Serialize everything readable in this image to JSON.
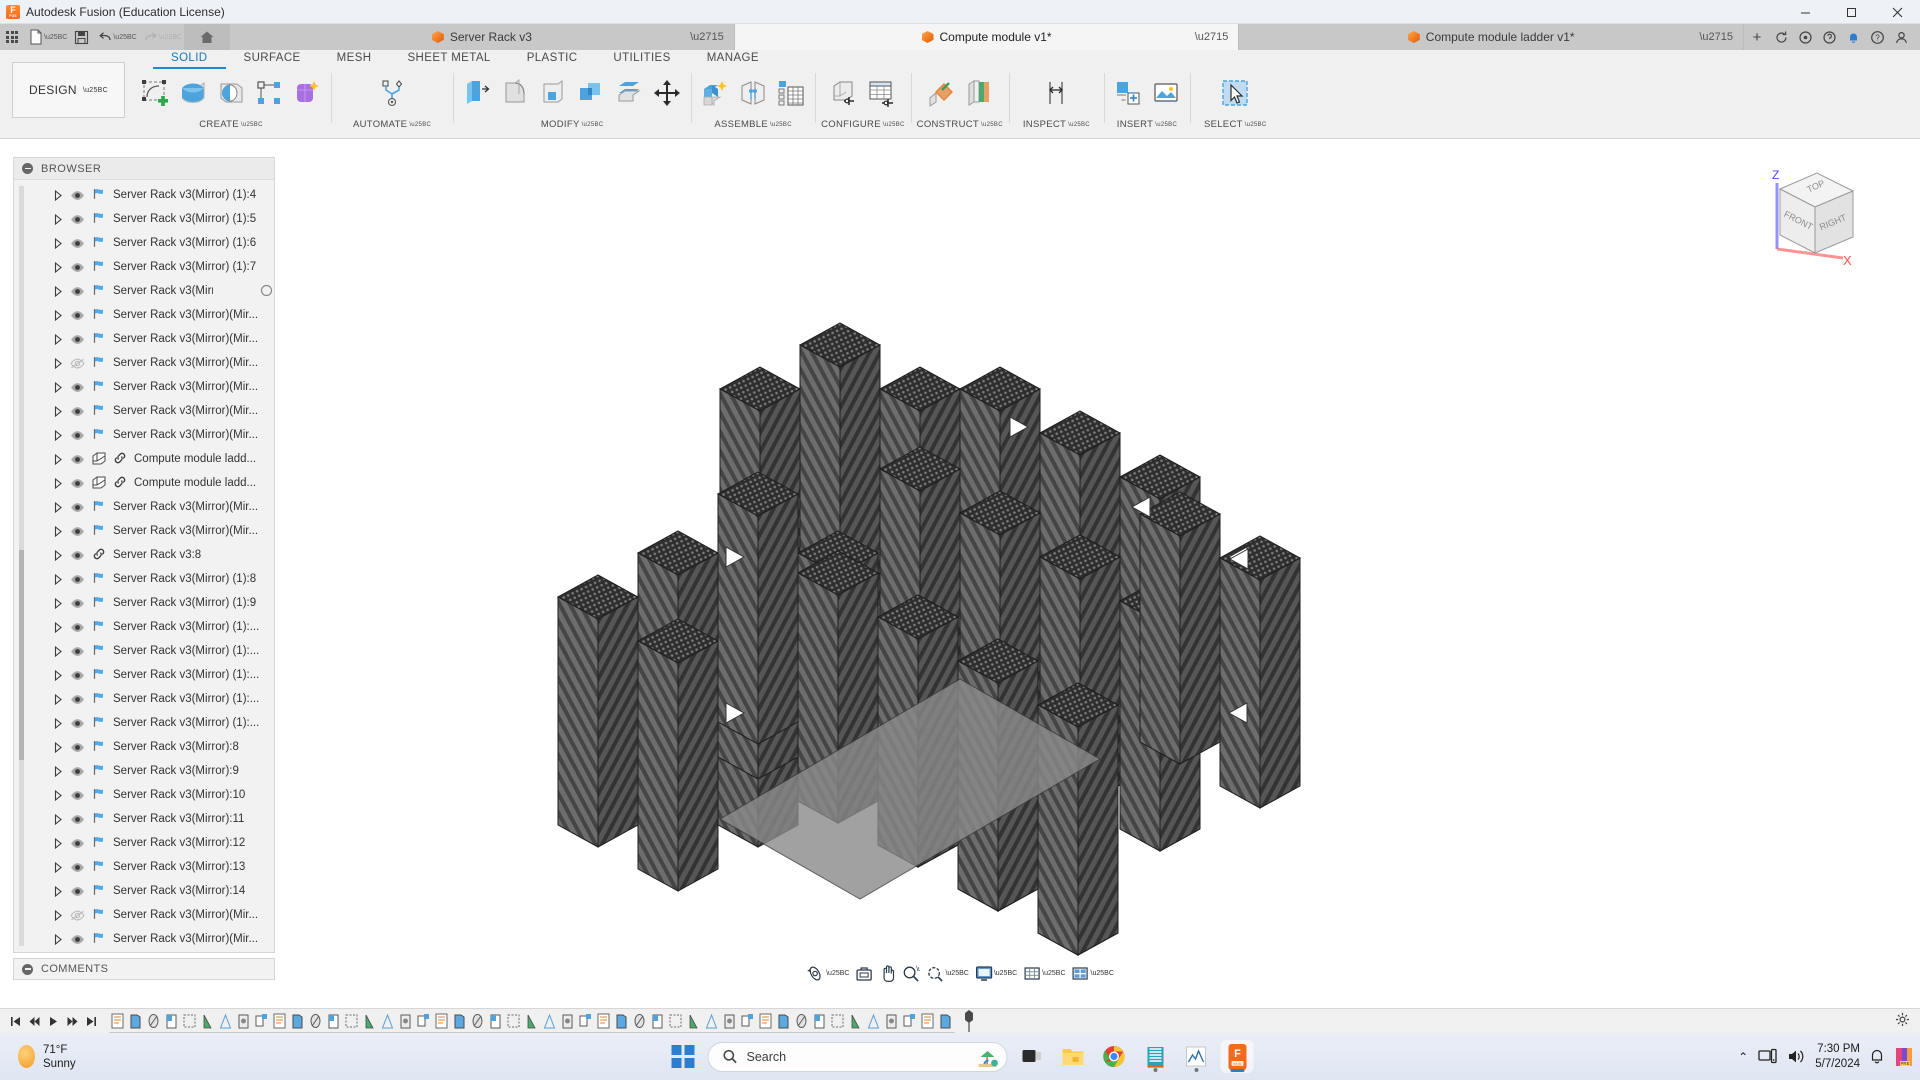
{
  "window": {
    "title": "Autodesk Fusion (Education License)",
    "app_icon": "fusion-logo-icon",
    "minimize": "─",
    "maximize": "□",
    "close": "✕"
  },
  "quick_access": {
    "items": [
      {
        "name": "app-grid-button",
        "icon": "grid-icon"
      },
      {
        "name": "new-file-button",
        "icon": "file-icon",
        "caret": true
      },
      {
        "name": "save-button",
        "icon": "save-icon"
      },
      {
        "name": "undo-button",
        "icon": "undo-arrow-icon",
        "caret": true
      },
      {
        "name": "redo-button",
        "icon": "redo-arrow-icon",
        "caret": true
      }
    ],
    "home_label": "home-icon",
    "add_tab": "+",
    "right_icons": [
      "refresh-icon",
      "extensions-icon",
      "help-circle-icon",
      "notification-bell-icon",
      "help-icon",
      "account-icon"
    ]
  },
  "doc_tabs": [
    {
      "label": "Server Rack v3",
      "active": false,
      "closable": true
    },
    {
      "label": "Compute module v1*",
      "active": true,
      "closable": true
    },
    {
      "label": "Compute module ladder v1*",
      "active": false,
      "closable": true
    }
  ],
  "ribbon": {
    "design_label": "DESIGN",
    "tabs": [
      {
        "label": "SOLID",
        "active": true
      },
      {
        "label": "SURFACE",
        "active": false
      },
      {
        "label": "MESH",
        "active": false
      },
      {
        "label": "SHEET METAL",
        "active": false
      },
      {
        "label": "PLASTIC",
        "active": false
      },
      {
        "label": "UTILITIES",
        "active": false
      },
      {
        "label": "MANAGE",
        "active": false
      }
    ],
    "groups": [
      {
        "label": "CREATE",
        "icons": [
          "sketch-create-icon",
          "extrude-icon",
          "revolve-icon",
          "rectangular-pattern-icon",
          "create-form-icon"
        ]
      },
      {
        "label": "AUTOMATE",
        "icons": [
          "automate-icon"
        ]
      },
      {
        "label": "MODIFY",
        "icons": [
          "press-pull-icon",
          "fillet-icon",
          "shell-icon",
          "combine-icon",
          "offset-face-icon",
          "move-copy-icon"
        ]
      },
      {
        "label": "ASSEMBLE",
        "icons": [
          "new-component-icon",
          "joint-icon",
          "contact-set-icon"
        ]
      },
      {
        "label": "CONFIGURE",
        "icons": [
          "create-configuration-icon",
          "configuration-table-icon"
        ]
      },
      {
        "label": "CONSTRUCT",
        "icons": [
          "offset-plane-icon",
          "plane-along-path-icon"
        ]
      },
      {
        "label": "INSPECT",
        "icons": [
          "measure-icon"
        ]
      },
      {
        "label": "INSERT",
        "icons": [
          "insert-derive-icon",
          "insert-canvas-icon"
        ]
      },
      {
        "label": "SELECT",
        "icons": [
          "select-cursor-icon"
        ]
      }
    ]
  },
  "browser": {
    "title": "BROWSER",
    "footer": "COMMENTS",
    "items": [
      {
        "label": "Server Rack v3(Mirror) (1):4",
        "visible": true,
        "icon": "joint-flag-icon"
      },
      {
        "label": "Server Rack v3(Mirror) (1):5",
        "visible": true,
        "icon": "joint-flag-icon"
      },
      {
        "label": "Server Rack v3(Mirror) (1):6",
        "visible": true,
        "icon": "joint-flag-icon"
      },
      {
        "label": "Server Rack v3(Mirror) (1):7",
        "visible": true,
        "icon": "joint-flag-icon"
      },
      {
        "label": "Server Rack v3(Mirrc...",
        "visible": true,
        "icon": "joint-flag-icon",
        "spinner": true
      },
      {
        "label": "Server Rack v3(Mirror)(Mir...",
        "visible": true,
        "icon": "joint-flag-icon"
      },
      {
        "label": "Server Rack v3(Mirror)(Mir...",
        "visible": true,
        "icon": "joint-flag-icon"
      },
      {
        "label": "Server Rack v3(Mirror)(Mir...",
        "visible": false,
        "icon": "joint-flag-icon"
      },
      {
        "label": "Server Rack v3(Mirror)(Mir...",
        "visible": true,
        "icon": "joint-flag-icon"
      },
      {
        "label": "Server Rack v3(Mirror)(Mir...",
        "visible": true,
        "icon": "joint-flag-icon"
      },
      {
        "label": "Server Rack v3(Mirror)(Mir...",
        "visible": true,
        "icon": "joint-flag-icon"
      },
      {
        "label": "Compute module ladd...",
        "visible": true,
        "icon": "component-link-icon"
      },
      {
        "label": "Compute module ladd...",
        "visible": true,
        "icon": "component-link-icon"
      },
      {
        "label": "Server Rack v3(Mirror)(Mir...",
        "visible": true,
        "icon": "joint-flag-icon"
      },
      {
        "label": "Server Rack v3(Mirror)(Mir...",
        "visible": true,
        "icon": "joint-flag-icon"
      },
      {
        "label": "Server Rack v3:8",
        "visible": true,
        "icon": "link-icon"
      },
      {
        "label": "Server Rack v3(Mirror) (1):8",
        "visible": true,
        "icon": "joint-flag-icon"
      },
      {
        "label": "Server Rack v3(Mirror) (1):9",
        "visible": true,
        "icon": "joint-flag-icon"
      },
      {
        "label": "Server Rack v3(Mirror) (1):...",
        "visible": true,
        "icon": "joint-flag-icon"
      },
      {
        "label": "Server Rack v3(Mirror) (1):...",
        "visible": true,
        "icon": "joint-flag-icon"
      },
      {
        "label": "Server Rack v3(Mirror) (1):...",
        "visible": true,
        "icon": "joint-flag-icon"
      },
      {
        "label": "Server Rack v3(Mirror) (1):...",
        "visible": true,
        "icon": "joint-flag-icon"
      },
      {
        "label": "Server Rack v3(Mirror) (1):...",
        "visible": true,
        "icon": "joint-flag-icon"
      },
      {
        "label": "Server Rack v3(Mirror):8",
        "visible": true,
        "icon": "joint-flag-icon"
      },
      {
        "label": "Server Rack v3(Mirror):9",
        "visible": true,
        "icon": "joint-flag-icon"
      },
      {
        "label": "Server Rack v3(Mirror):10",
        "visible": true,
        "icon": "joint-flag-icon"
      },
      {
        "label": "Server Rack v3(Mirror):11",
        "visible": true,
        "icon": "joint-flag-icon"
      },
      {
        "label": "Server Rack v3(Mirror):12",
        "visible": true,
        "icon": "joint-flag-icon"
      },
      {
        "label": "Server Rack v3(Mirror):13",
        "visible": true,
        "icon": "joint-flag-icon"
      },
      {
        "label": "Server Rack v3(Mirror):14",
        "visible": true,
        "icon": "joint-flag-icon"
      },
      {
        "label": "Server Rack v3(Mirror)(Mir...",
        "visible": false,
        "icon": "joint-flag-icon"
      },
      {
        "label": "Server Rack v3(Mirror)(Mir...",
        "visible": true,
        "icon": "joint-flag-icon"
      }
    ]
  },
  "viewcube": {
    "top": "TOP",
    "front": "FRONT",
    "right": "RIGHT",
    "axis_z": "Z",
    "axis_x": "X"
  },
  "navbar": {
    "items": [
      {
        "name": "orbit-button",
        "icon": "orbit-icon",
        "caret": true
      },
      {
        "name": "look-at-button",
        "icon": "look-at-icon",
        "caret": false
      },
      {
        "name": "pan-button",
        "icon": "pan-hand-icon",
        "caret": false
      },
      {
        "name": "zoom-button",
        "icon": "zoom-magnifier-icon",
        "caret": false
      },
      {
        "name": "zoom-window-button",
        "icon": "zoom-window-icon",
        "caret": true
      },
      {
        "name": "display-settings-button",
        "icon": "display-monitor-icon",
        "caret": true
      },
      {
        "name": "grid-snaps-button",
        "icon": "grid-snap-icon",
        "caret": true
      },
      {
        "name": "viewports-button",
        "icon": "viewports-icon",
        "caret": true
      }
    ]
  },
  "timeline": {
    "playback": [
      "skip-start-icon",
      "step-back-icon",
      "play-icon",
      "step-forward-icon",
      "skip-end-icon"
    ],
    "feature_count": 47,
    "marker": "timeline-end-marker"
  },
  "taskbar": {
    "weather": {
      "temp": "71°F",
      "cond": "Sunny"
    },
    "search_placeholder": "Search",
    "apps": [
      {
        "name": "taskview-icon",
        "running": false
      },
      {
        "name": "widgets-icon",
        "running": false
      },
      {
        "name": "file-explorer-icon",
        "running": false
      },
      {
        "name": "chrome-icon",
        "running": false
      },
      {
        "name": "editor-icon",
        "running": true
      },
      {
        "name": "analytics-icon",
        "running": true
      },
      {
        "name": "fusion-icon",
        "running": true,
        "active": true
      }
    ],
    "tray": {
      "chevron": "⌃",
      "network": "network-icon",
      "volume": "volume-icon",
      "time": "7:30 PM",
      "date": "5/7/2024",
      "bell": "notification-bell-icon",
      "extra": "pre-app-icon"
    }
  },
  "colors": {
    "accent": "#1a8ad4",
    "orange": "#f0761e",
    "ribbon_bg": "#f0f0f0",
    "tabbar_bg": "#c8c8c8",
    "model_dark": "#3a3a3a"
  }
}
